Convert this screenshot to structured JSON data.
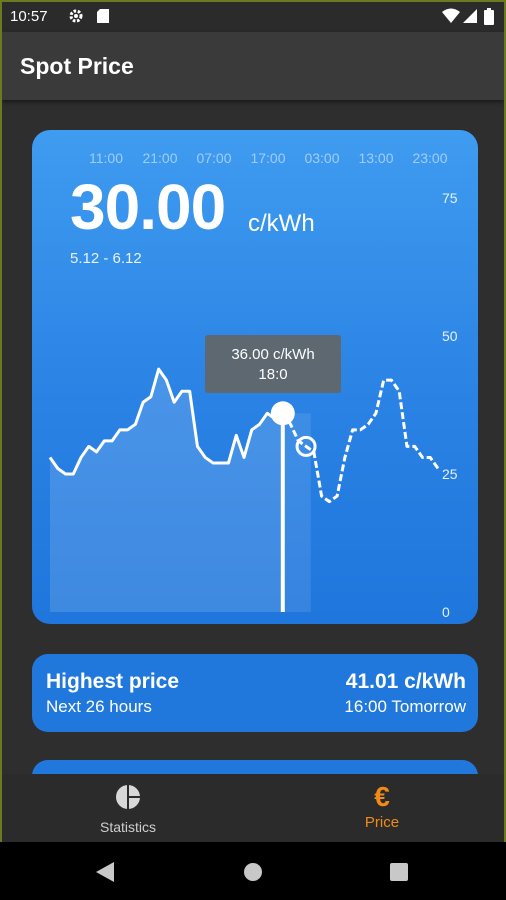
{
  "status_bar": {
    "time": "10:57",
    "icons": [
      "gear-icon",
      "sd-card-icon",
      "wifi-icon",
      "signal-icon",
      "battery-icon"
    ]
  },
  "app_bar": {
    "title": "Spot Price"
  },
  "chart_card": {
    "current_price": "30.00",
    "unit": "c/kWh",
    "date_range": "5.12 - 6.12",
    "tooltip": {
      "price": "36.00 c/kWh",
      "time": "18:0"
    },
    "gradient": [
      "#3f9cf0",
      "#1f76dc"
    ]
  },
  "chart_data": {
    "type": "line",
    "x_tick_labels": [
      "11:00",
      "21:00",
      "07:00",
      "17:00",
      "03:00",
      "13:00",
      "23:00"
    ],
    "y_ticks": [
      0,
      25,
      50,
      75
    ],
    "ylim": [
      0,
      75
    ],
    "selected_index": 30,
    "series": [
      {
        "values": [
          28,
          26,
          25,
          25,
          28,
          30,
          29,
          31,
          31,
          33,
          33,
          34,
          38,
          39,
          44,
          42,
          38,
          40,
          40,
          30,
          28,
          27,
          27,
          27,
          32,
          28,
          33,
          34,
          36,
          35,
          36,
          34,
          31,
          30,
          29,
          21,
          20,
          21,
          28,
          33,
          33,
          34,
          36,
          42,
          42,
          40,
          30,
          30,
          28,
          28,
          26
        ]
      }
    ]
  },
  "highest_price_card": {
    "title": "Highest price",
    "subtitle": "Next 26 hours",
    "price": "41.01 c/kWh",
    "when": "16:00 Tomorrow"
  },
  "bottom_nav": {
    "statistics_label": "Statistics",
    "price_label": "Price",
    "price_symbol": "€",
    "active_color": "#f08c16"
  }
}
